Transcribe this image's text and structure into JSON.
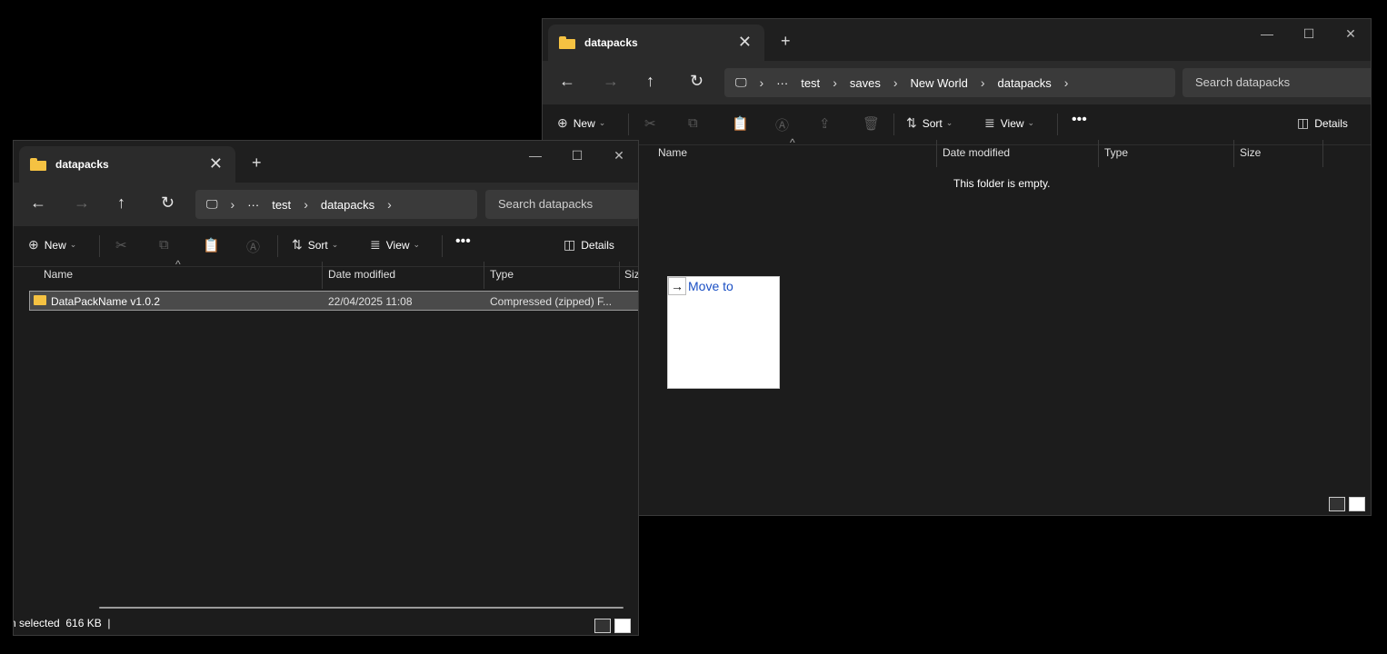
{
  "right_window": {
    "tab_title": "datapacks",
    "win_controls": [
      "—",
      "☐",
      "✕"
    ],
    "breadcrumb": [
      "test",
      "saves",
      "New World",
      "datapacks"
    ],
    "search_placeholder": "Search datapacks",
    "toolbar": {
      "new_label": "New",
      "sort_label": "Sort",
      "view_label": "View",
      "details_label": "Details"
    },
    "columns": [
      "Name",
      "Date modified",
      "Type",
      "Size"
    ],
    "empty_text": "This folder is empty."
  },
  "left_window": {
    "tab_title": "datapacks",
    "win_controls": [
      "—",
      "☐",
      "✕"
    ],
    "breadcrumb": [
      "test",
      "datapacks"
    ],
    "search_placeholder": "Search datapacks",
    "toolbar": {
      "new_label": "New",
      "sort_label": "Sort",
      "view_label": "View",
      "details_label": "Details"
    },
    "columns": [
      "Name",
      "Date modified",
      "Type",
      "Siz"
    ],
    "files": [
      {
        "name": "DataPackName v1.0.2",
        "date": "22/04/2025 11:08",
        "type": "Compressed (zipped) F..."
      }
    ],
    "status": "n selected  616 KB  |"
  },
  "drag_tooltip": {
    "label": "Move to"
  },
  "colors": {
    "folder": "#f5c242",
    "link_blue": "#1a4fc4"
  }
}
